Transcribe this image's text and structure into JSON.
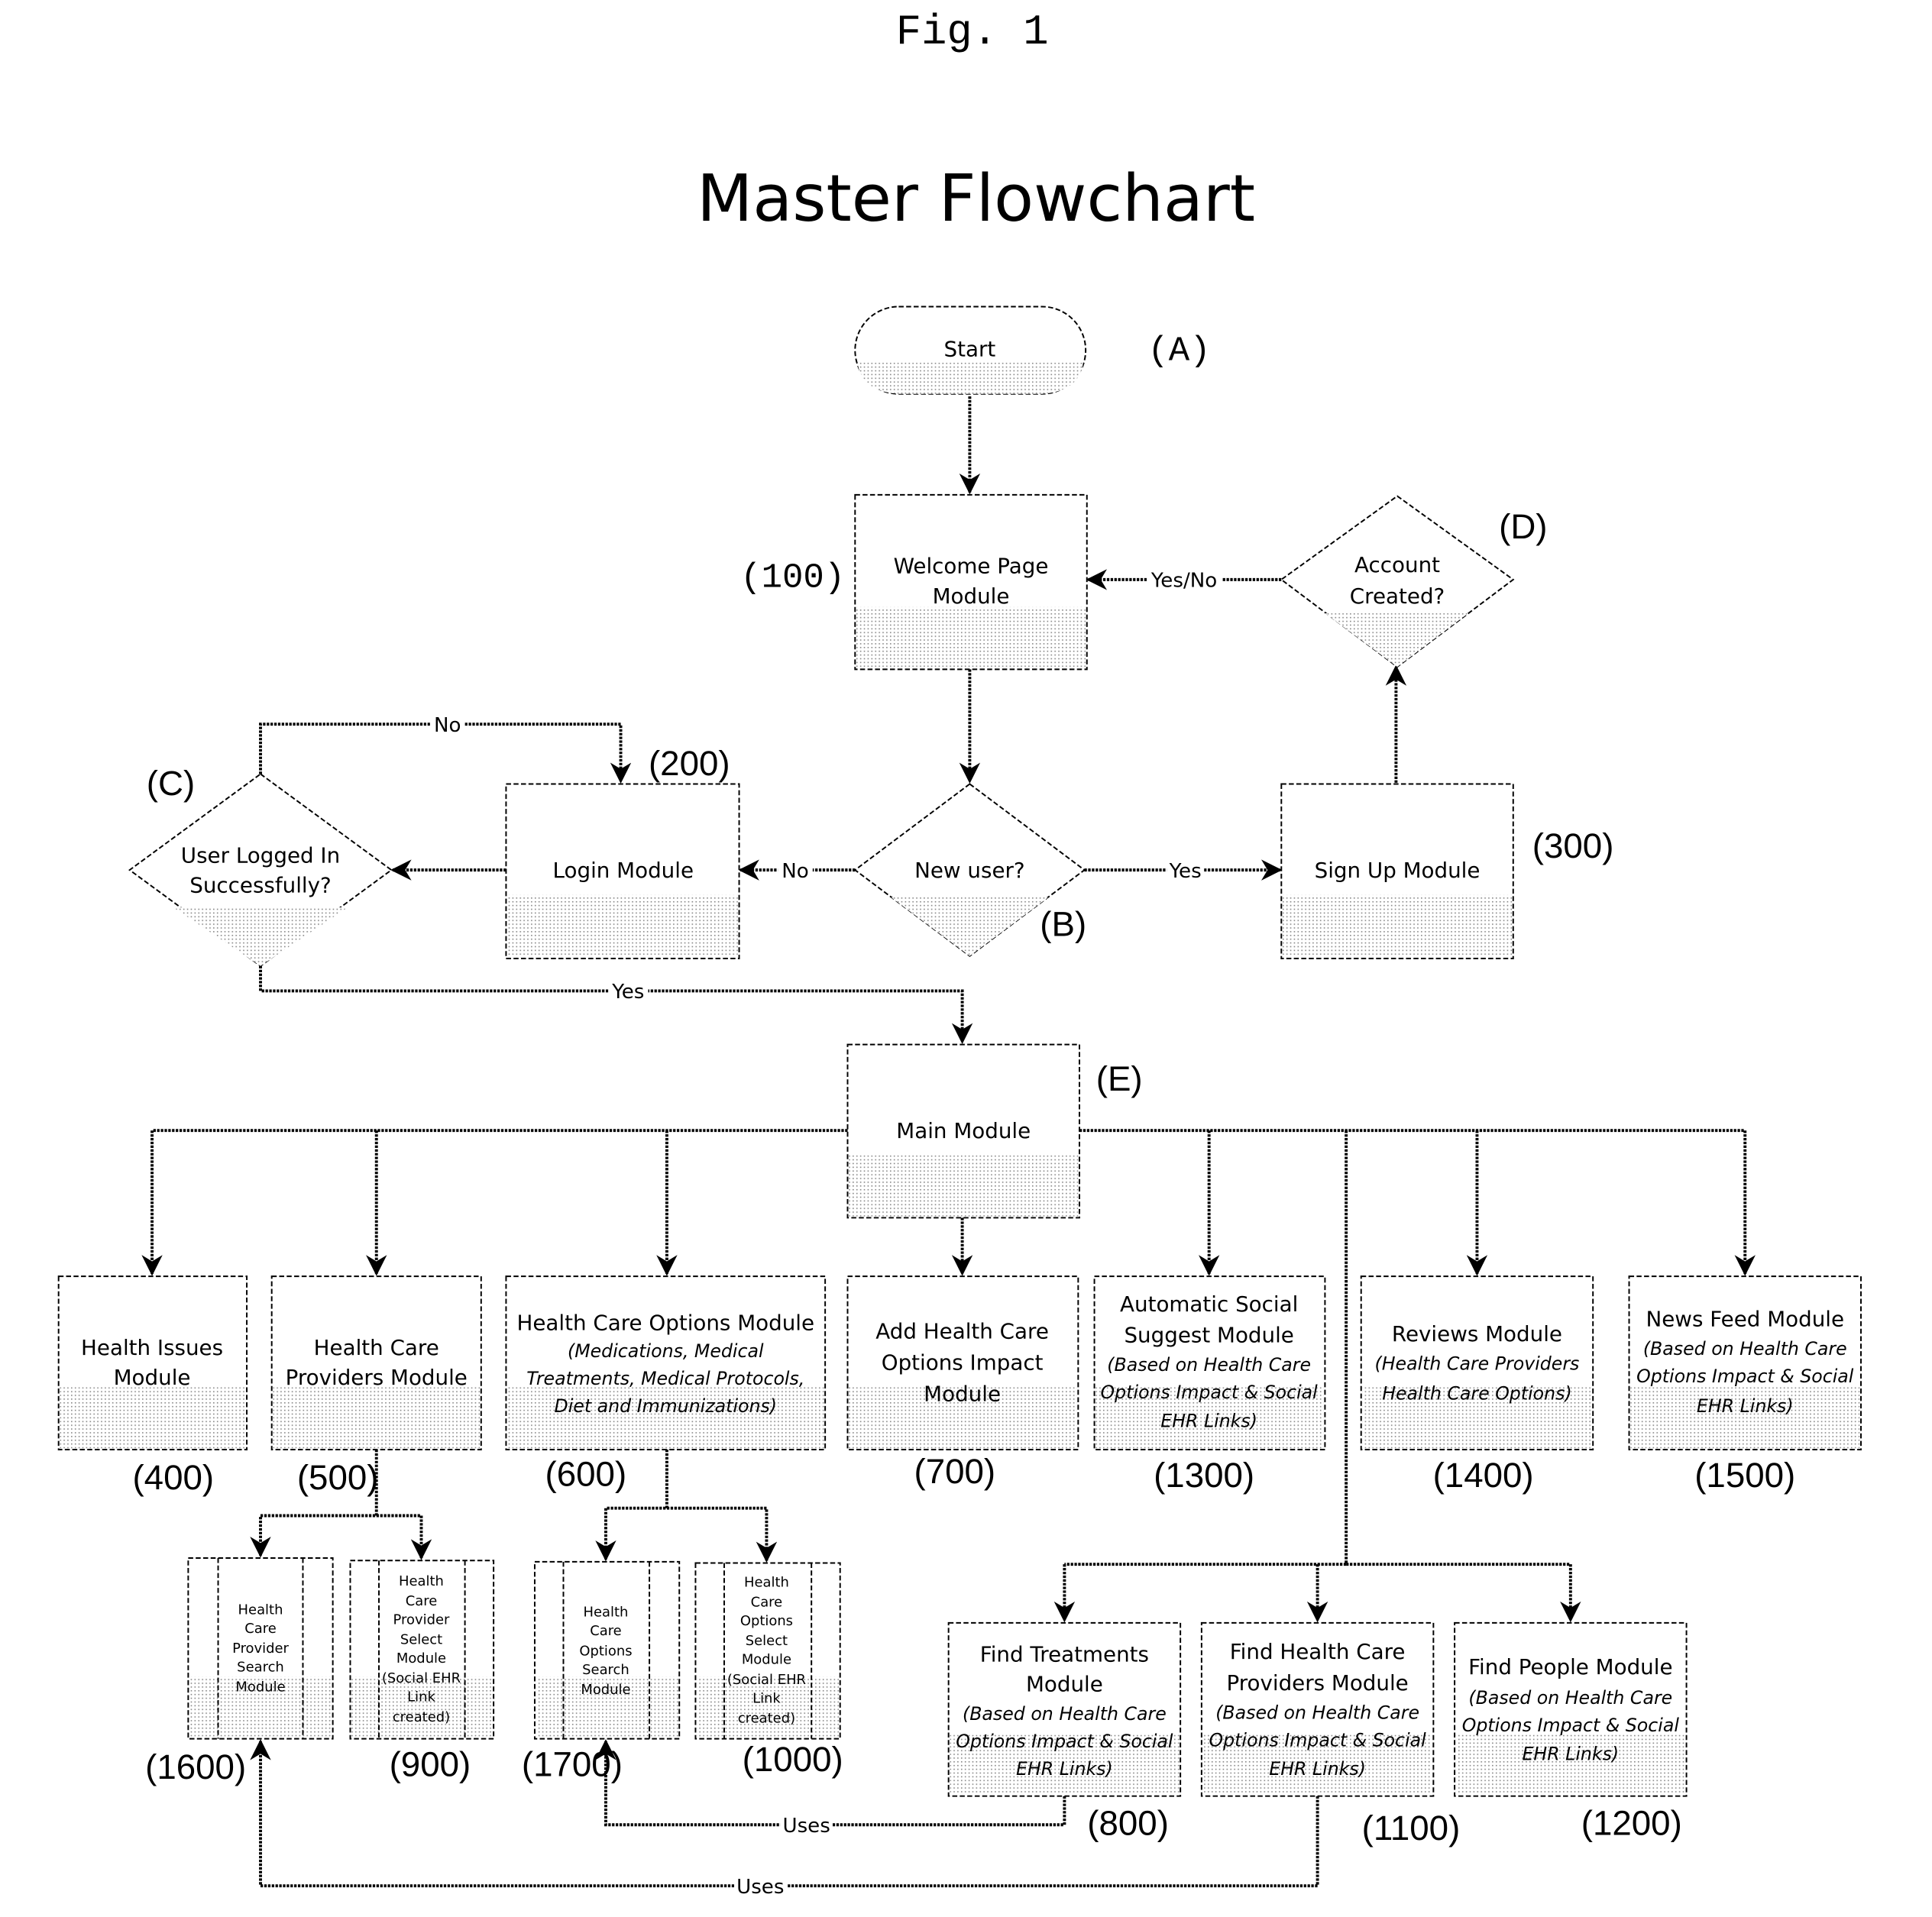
{
  "figure_label": "Fig. 1",
  "title": "Master Flowchart",
  "nodes": {
    "start": {
      "label": "Start",
      "ref": "(A)"
    },
    "welcome": {
      "lines": [
        "Welcome Page",
        "Module"
      ],
      "ref": "(100)"
    },
    "new_user": {
      "label": "New user?",
      "ref": "(B)"
    },
    "login": {
      "label": "Login Module",
      "ref": "(200)"
    },
    "signup": {
      "label": "Sign Up Module",
      "ref": "(300)"
    },
    "logged_in": {
      "lines": [
        "User Logged In",
        "Successfully?"
      ],
      "ref": "(C)"
    },
    "account_created": {
      "lines": [
        "Account",
        "Created?"
      ],
      "ref": "(D)"
    },
    "main": {
      "label": "Main Module",
      "ref": "(E)"
    },
    "health_issues": {
      "lines": [
        "Health Issues",
        "Module"
      ],
      "ref": "(400)"
    },
    "providers": {
      "lines": [
        "Health Care",
        "Providers Module"
      ],
      "ref": "(500)"
    },
    "options": {
      "lines": [
        "Health Care Options Module"
      ],
      "sub": [
        "(Medications, Medical",
        "Treatments, Medical Protocols,",
        "Diet and Immunizations)"
      ],
      "ref": "(600)"
    },
    "add_impact": {
      "lines": [
        "Add Health Care",
        "Options Impact",
        "Module"
      ],
      "ref": "(700)"
    },
    "auto_suggest": {
      "lines": [
        "Automatic Social",
        "Suggest Module"
      ],
      "sub": [
        "(Based on Health Care",
        "Options Impact & Social",
        "EHR Links)"
      ],
      "ref": "(1300)"
    },
    "reviews": {
      "lines": [
        "Reviews Module"
      ],
      "sub": [
        "(Health Care Providers",
        "Health Care Options)"
      ],
      "ref": "(1400)"
    },
    "news_feed": {
      "lines": [
        "News Feed Module"
      ],
      "sub": [
        "(Based on Health Care",
        "Options Impact & Social",
        "EHR Links)"
      ],
      "ref": "(1500)"
    },
    "provider_search": {
      "lines": [
        "Health",
        "Care",
        "Provider",
        "Search",
        "Module"
      ],
      "ref": "(1600)"
    },
    "provider_select": {
      "lines": [
        "Health",
        "Care",
        "Provider",
        "Select",
        "Module",
        "(Social EHR",
        "Link",
        "created)"
      ],
      "ref": "(900)"
    },
    "options_search": {
      "lines": [
        "Health",
        "Care",
        "Options",
        "Search",
        "Module"
      ],
      "ref": "(1700)"
    },
    "options_select": {
      "lines": [
        "Health",
        "Care",
        "Options",
        "Select",
        "Module",
        "(Social EHR",
        "Link",
        "created)"
      ],
      "ref": "(1000)"
    },
    "find_treatments": {
      "lines": [
        "Find Treatments",
        "Module"
      ],
      "sub": [
        "(Based on Health Care",
        "Options Impact & Social",
        "EHR Links)"
      ],
      "ref": "(800)"
    },
    "find_providers": {
      "lines": [
        "Find Health Care",
        "Providers Module"
      ],
      "sub": [
        "(Based on Health Care",
        "Options Impact & Social",
        "EHR Links)"
      ],
      "ref": "(1100)"
    },
    "find_people": {
      "lines": [
        "Find People Module"
      ],
      "sub": [
        "(Based on Health Care",
        "Options Impact & Social",
        "EHR Links)"
      ],
      "ref": "(1200)"
    }
  },
  "edge_labels": {
    "yes_no": "Yes/No",
    "new_user_no": "No",
    "new_user_yes": "Yes",
    "login_retry_no": "No",
    "logged_in_yes": "Yes",
    "uses_treatments": "Uses",
    "uses_providers": "Uses"
  }
}
